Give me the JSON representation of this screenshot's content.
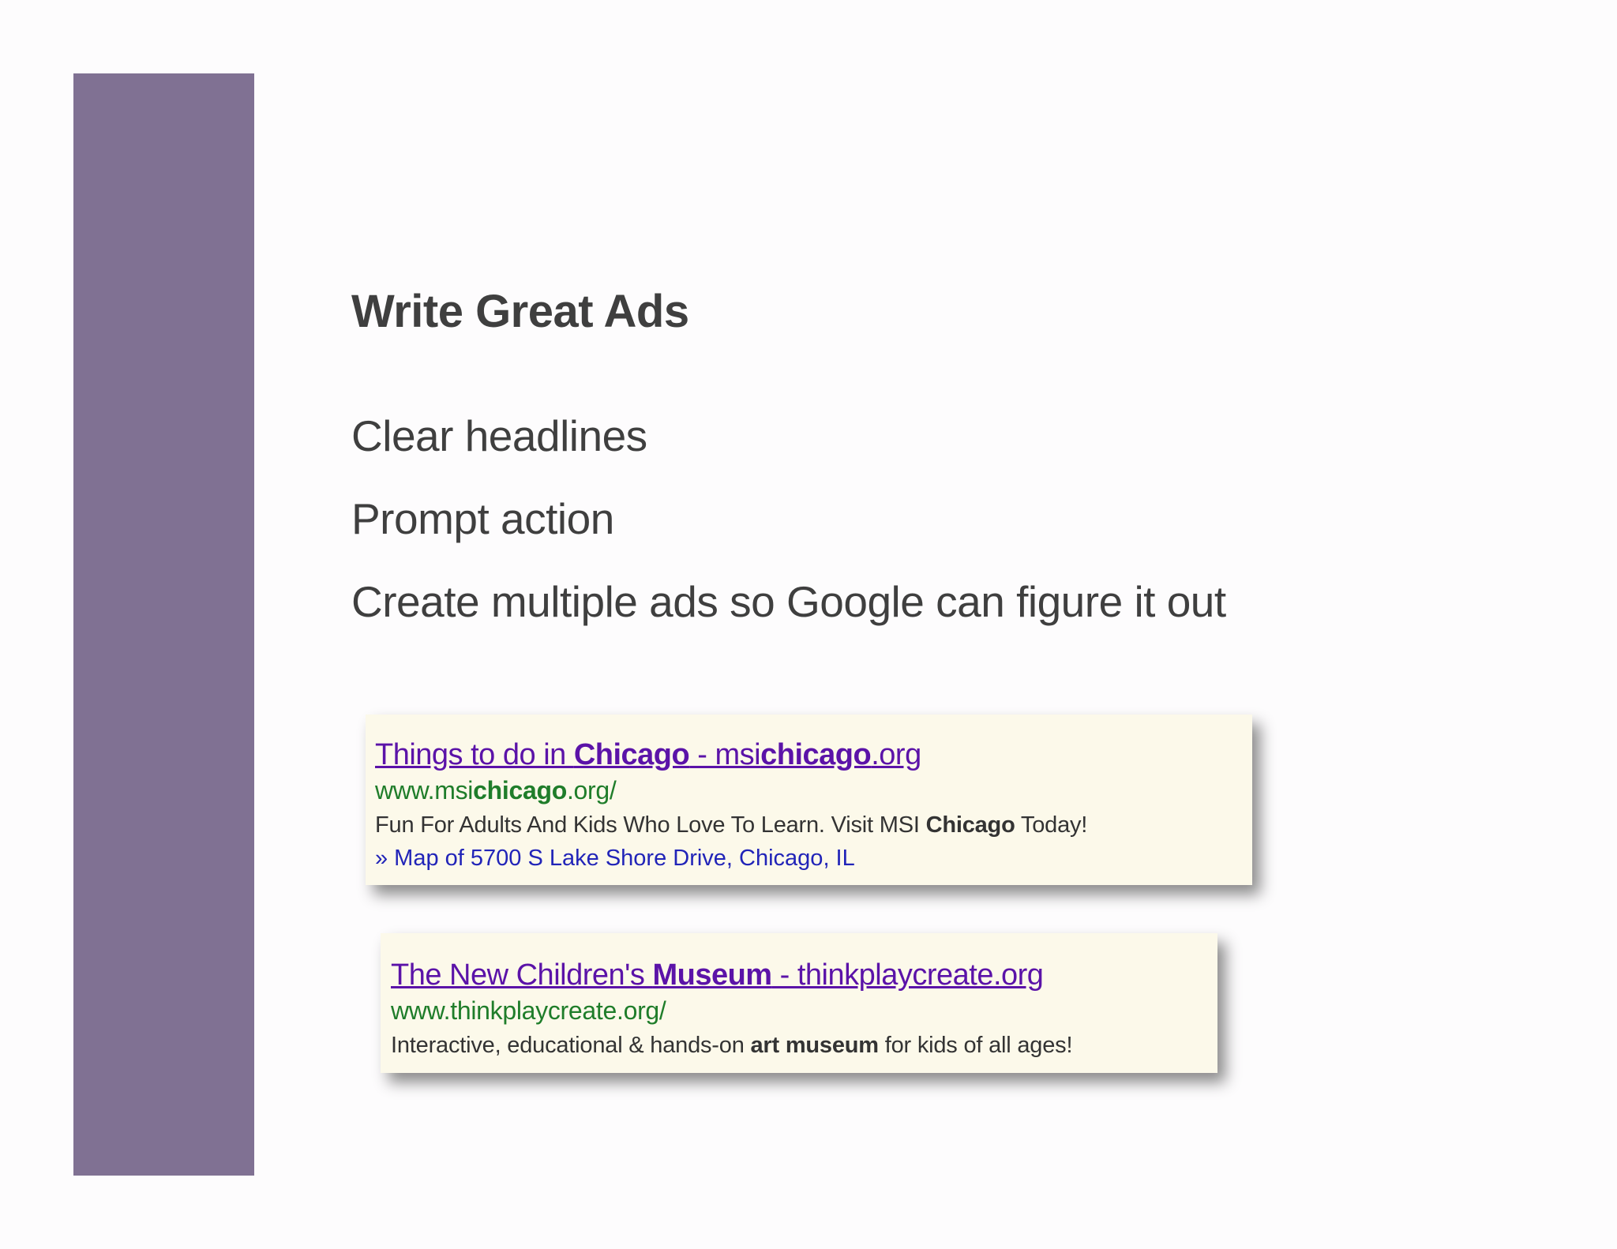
{
  "slide": {
    "title": "Write Great Ads",
    "bullets": [
      "Clear headlines",
      "Prompt action",
      "Create multiple ads so Google can figure it out"
    ]
  },
  "ads": [
    {
      "headline": {
        "part1": "Things to do in ",
        "part2_bold": "Chicago",
        "part3": " - msi",
        "part4_bold": "chicago",
        "part5": ".org"
      },
      "display_url": {
        "part1": "www.msi",
        "part2_bold": "chicago",
        "part3": ".org/"
      },
      "description": {
        "part1": "Fun For Adults And Kids Who Love To Learn. Visit MSI ",
        "part2_bold": "Chicago",
        "part3": " Today!"
      },
      "sitelink": "» Map of 5700 S Lake Shore Drive, Chicago, IL"
    },
    {
      "headline": {
        "part1": "The New Children's ",
        "part2_bold": "Museum",
        "part3": " - thinkplaycreate.org"
      },
      "display_url": {
        "part1": "www.thinkplaycreate.org/"
      },
      "description": {
        "part1": "Interactive, educational & hands-on ",
        "part2_bold": "art museum",
        "part3": " for kids of all ages!"
      }
    }
  ],
  "colors": {
    "side_bar": "#807193",
    "title_text": "#3f3f3f",
    "ad_background": "#fcf9ea",
    "ad_headline": "#5b13a8",
    "ad_url": "#1f7d2a",
    "ad_sitelink": "#2124b8"
  }
}
